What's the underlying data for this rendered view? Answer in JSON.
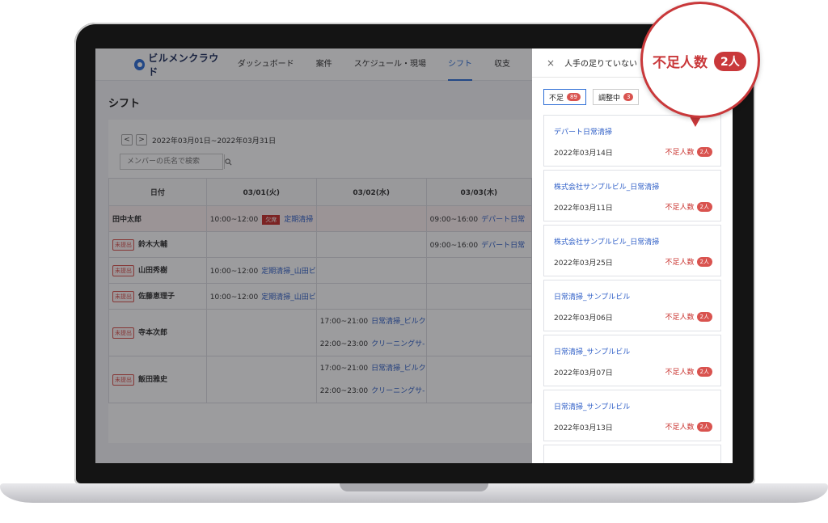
{
  "app": {
    "logo_text": "ビルメンクラウド",
    "nav": [
      "ダッシュボード",
      "案件",
      "スケジュール・現場",
      "シフト",
      "収支"
    ],
    "nav_active": "シフト"
  },
  "page": {
    "title": "シフト",
    "prev_label": "<",
    "next_label": ">",
    "date_range": "2022年03月01日~2022年03月31日",
    "search_placeholder": "メンバーの氏名で検索"
  },
  "table": {
    "headers": [
      "日付",
      "03/01(火)",
      "03/02(水)",
      "03/03(木)"
    ],
    "rows": [
      {
        "name": "田中太郎",
        "badge": "",
        "cells": [
          [
            {
              "time": "10:00~12:00",
              "absent": "欠席",
              "site": "定期清掃"
            }
          ],
          [],
          [
            {
              "time": "09:00~16:00",
              "absent": "",
              "site": "デパート日常"
            }
          ]
        ]
      },
      {
        "name": "鈴木大輔",
        "badge": "未提出",
        "cells": [
          [],
          [],
          [
            {
              "time": "09:00~16:00",
              "absent": "",
              "site": "デパート日常"
            }
          ]
        ]
      },
      {
        "name": "山田秀樹",
        "badge": "未提出",
        "cells": [
          [
            {
              "time": "10:00~12:00",
              "absent": "",
              "site": "定期清掃_山田ビ"
            }
          ],
          [],
          []
        ]
      },
      {
        "name": "佐藤恵理子",
        "badge": "未提出",
        "cells": [
          [
            {
              "time": "10:00~12:00",
              "absent": "",
              "site": "定期清掃_山田ビ"
            }
          ],
          [],
          []
        ]
      },
      {
        "name": "寺本次郎",
        "badge": "未提出",
        "cells": [
          [],
          [
            {
              "time": "17:00~21:00",
              "absent": "",
              "site": "日常清掃_ビルク"
            },
            {
              "time": "22:00~23:00",
              "absent": "",
              "site": "クリーニングサ-"
            }
          ],
          []
        ]
      },
      {
        "name": "飯田雅史",
        "badge": "未提出",
        "cells": [
          [],
          [
            {
              "time": "17:00~21:00",
              "absent": "",
              "site": "日常清掃_ビルク"
            },
            {
              "time": "22:00~23:00",
              "absent": "",
              "site": "クリーニングサ-"
            }
          ],
          []
        ]
      }
    ]
  },
  "panel": {
    "close_label": "×",
    "title": "人手の足りていない",
    "filters": [
      {
        "label": "不足",
        "count": "89"
      },
      {
        "label": "調整中",
        "count": "3"
      }
    ],
    "items": [
      {
        "title": "デパート日常清掃",
        "date": "2022年03月14日",
        "short_label": "不足人数",
        "short_count": "2人"
      },
      {
        "title": "株式会社サンプルビル_日常清掃",
        "date": "2022年03月11日",
        "short_label": "不足人数",
        "short_count": "2人"
      },
      {
        "title": "株式会社サンプルビル_日常清掃",
        "date": "2022年03月25日",
        "short_label": "不足人数",
        "short_count": "2人"
      },
      {
        "title": "日常清掃_サンプルビル",
        "date": "2022年03月06日",
        "short_label": "不足人数",
        "short_count": "2人"
      },
      {
        "title": "日常清掃_サンプルビル",
        "date": "2022年03月07日",
        "short_label": "不足人数",
        "short_count": "2人"
      },
      {
        "title": "日常清掃_サンプルビル",
        "date": "2022年03月13日",
        "short_label": "不足人数",
        "short_count": "2人"
      }
    ]
  },
  "callout": {
    "label": "不足人数",
    "count": "2人"
  },
  "colors": {
    "accent": "#2f6fd6",
    "alert": "#c9383a"
  }
}
